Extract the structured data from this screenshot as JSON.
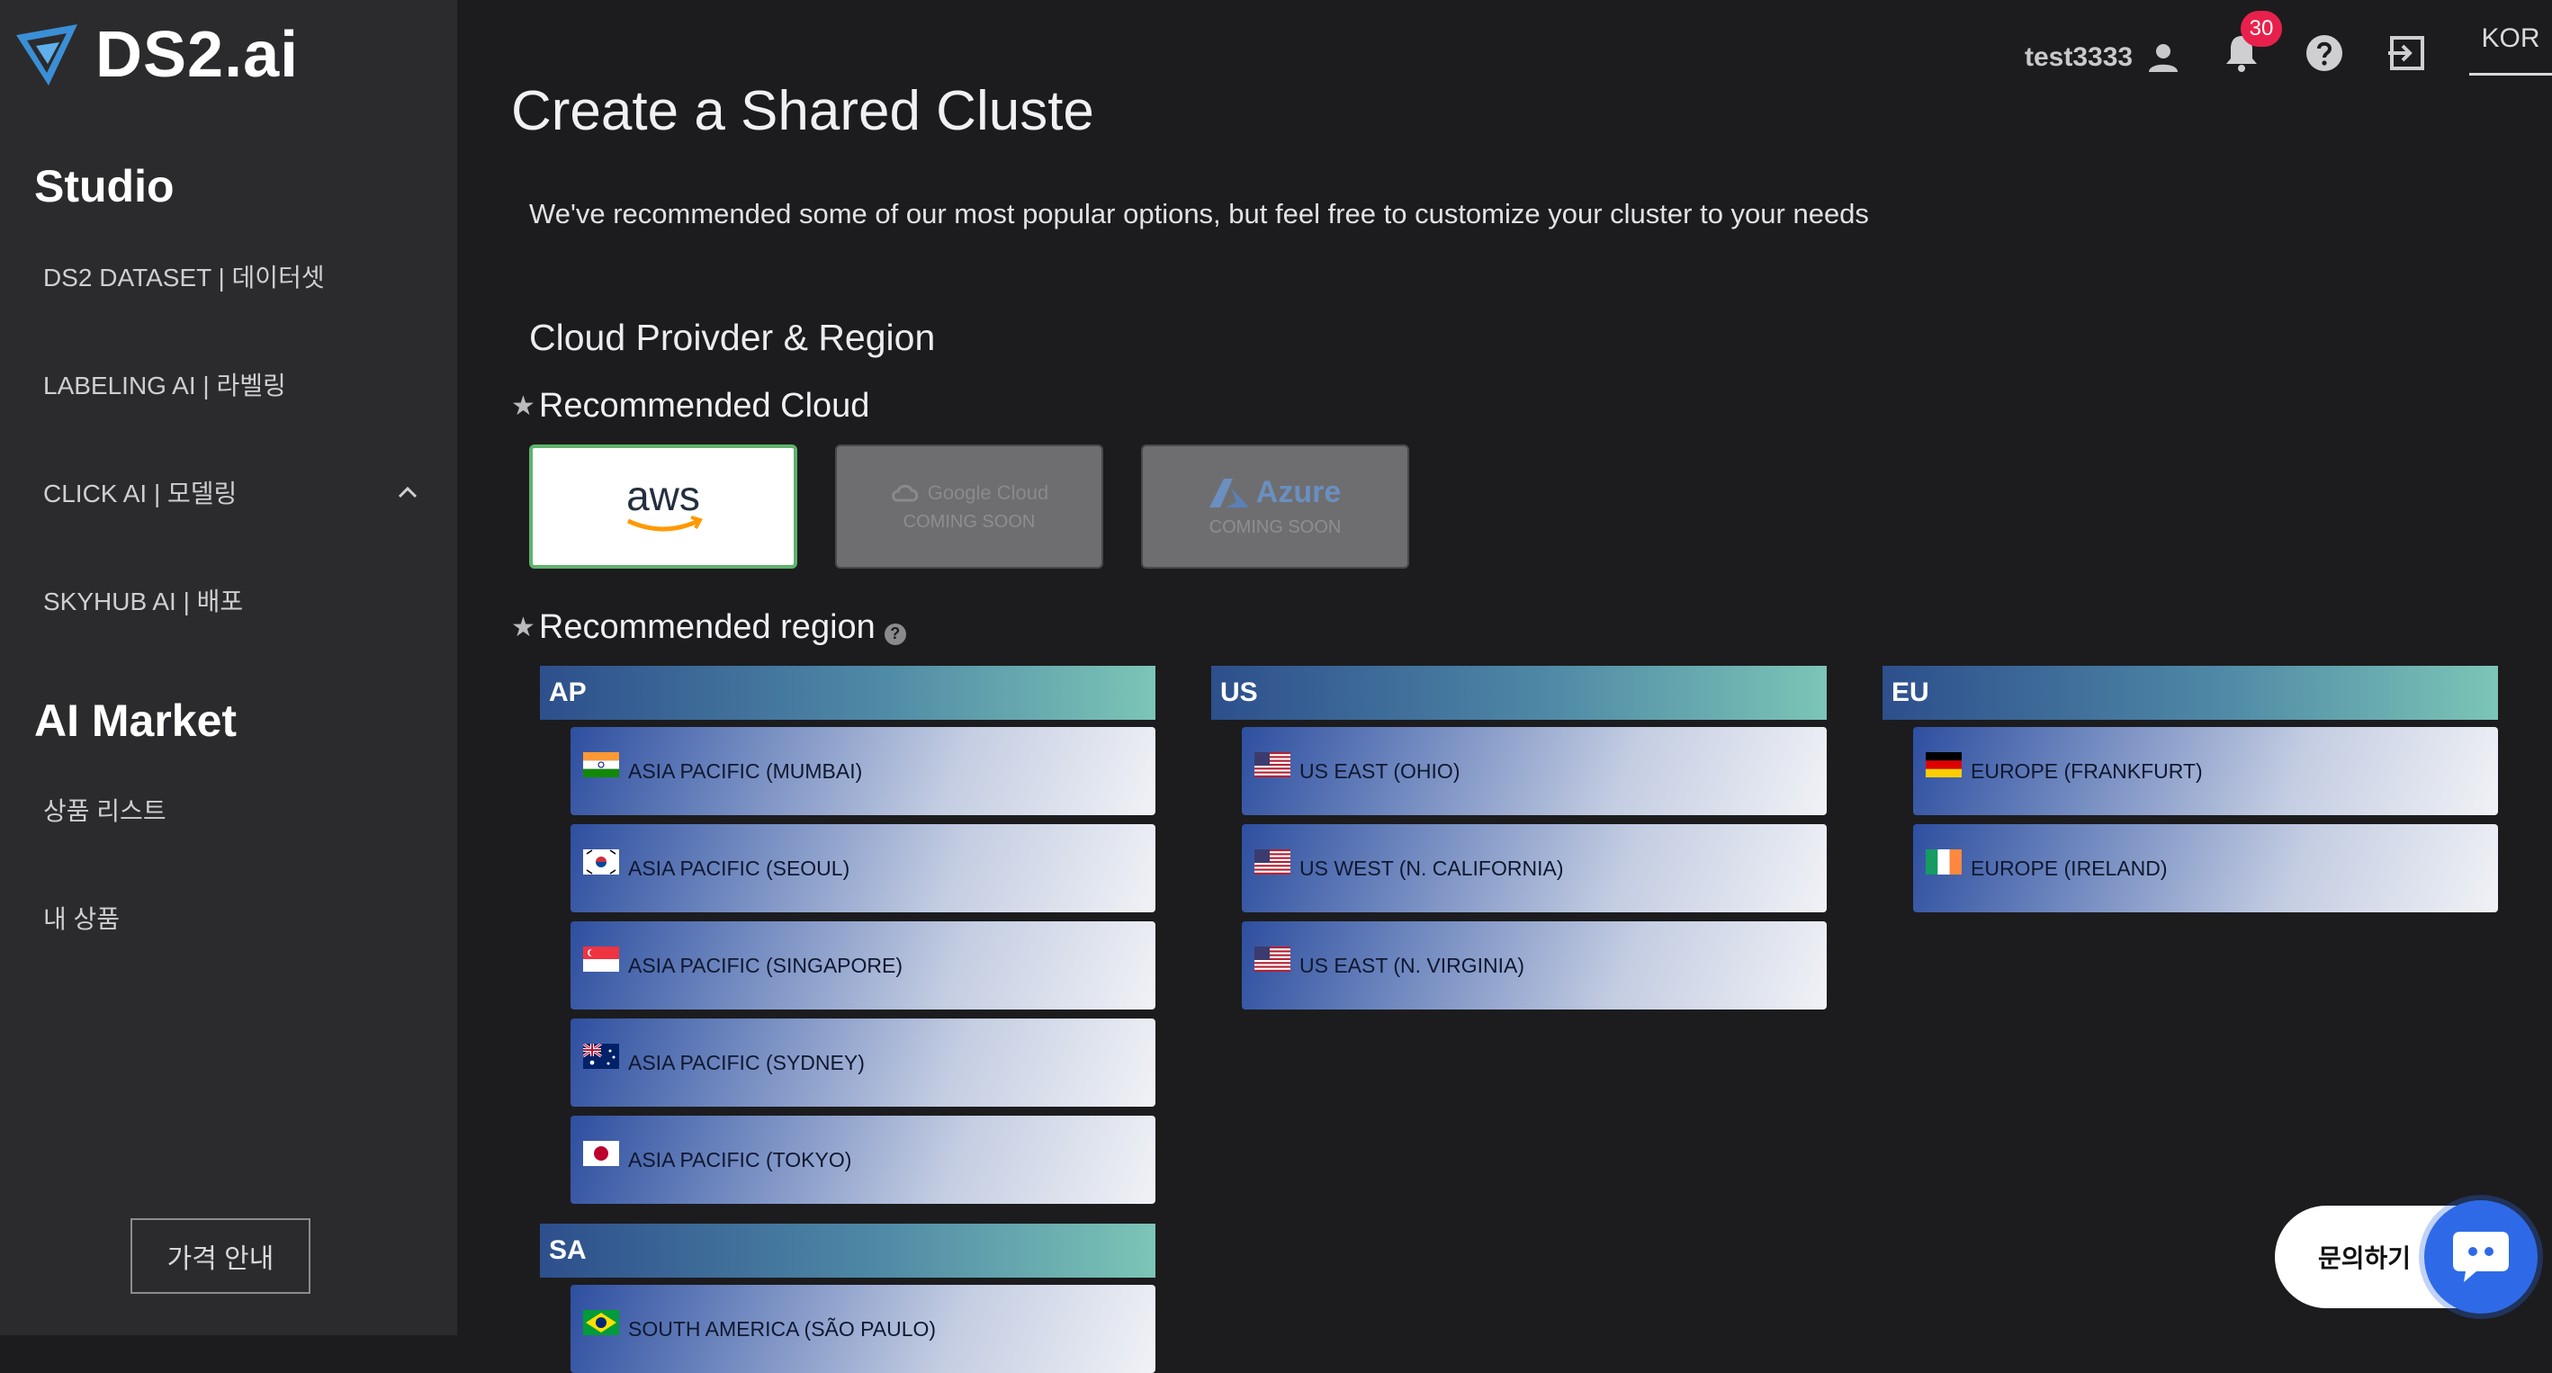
{
  "brand": {
    "name": "DS2.ai"
  },
  "sidebar": {
    "studio_heading": "Studio",
    "studio_items": [
      {
        "label": "DS2 DATASET | 데이터셋"
      },
      {
        "label": "LABELING AI | 라벨링"
      },
      {
        "label": "CLICK AI | 모델링",
        "expanded": true
      },
      {
        "label": "SKYHUB AI | 배포"
      }
    ],
    "market_heading": "AI Market",
    "market_items": [
      {
        "label": "상품 리스트"
      },
      {
        "label": "내 상품"
      }
    ],
    "pricing_button": "가격 안내"
  },
  "header": {
    "username": "test3333",
    "notification_count": "30",
    "language": "KOR"
  },
  "main": {
    "title": "Create a Shared Cluste",
    "subtitle": "We've recommended some of our most popular options, but feel free to customize your cluster to your needs",
    "section_title": "Cloud Proivder & Region",
    "recommended_cloud_label": "Recommended Cloud",
    "recommended_region_label": "Recommended region",
    "clouds": [
      {
        "name": "aws",
        "selected": true,
        "status": ""
      },
      {
        "name": "Google Cloud",
        "selected": false,
        "status": "COMING SOON"
      },
      {
        "name": "Azure",
        "selected": false,
        "status": "COMING SOON"
      }
    ],
    "region_groups": [
      {
        "code": "AP",
        "regions": [
          "ASIA PACIFIC (MUMBAI)",
          "ASIA PACIFIC (SEOUL)",
          "ASIA PACIFIC (SINGAPORE)",
          "ASIA PACIFIC (SYDNEY)",
          "ASIA PACIFIC (TOKYO)"
        ]
      },
      {
        "code": "US",
        "regions": [
          "US EAST (OHIO)",
          "US WEST (N. CALIFORNIA)",
          "US EAST (N. VIRGINIA)"
        ]
      },
      {
        "code": "EU",
        "regions": [
          "EUROPE (FRANKFURT)",
          "EUROPE (IRELAND)"
        ]
      },
      {
        "code": "SA",
        "regions": [
          "SOUTH AMERICA (SÃO PAULO)"
        ]
      }
    ]
  },
  "chat": {
    "label": "문의하기"
  },
  "colors": {
    "accent_green": "#5fb26c",
    "badge_red": "#e8214c",
    "chat_blue": "#2e6ae8"
  }
}
